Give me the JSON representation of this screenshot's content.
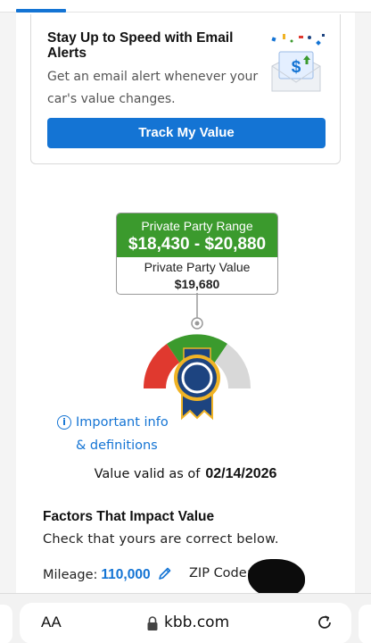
{
  "alert": {
    "title": "Stay Up to Speed with Email Alerts",
    "description": "Get an email alert whenever your car's value changes.",
    "button_label": "Track My Value"
  },
  "valuation": {
    "range_label": "Private Party Range",
    "range_value": "$18,430 - $20,880",
    "value_label": "Private Party Value",
    "value": "$19,680"
  },
  "info": {
    "icon_glyph": "i",
    "line1": "Important info",
    "line2": "& definitions"
  },
  "validity": {
    "label": "Value valid as of",
    "date": "02/14/2026"
  },
  "factors": {
    "title": "Factors That Impact Value",
    "subtitle": "Check that yours are correct below.",
    "mileage_label": "Mileage:",
    "mileage_value": "110,000",
    "zip_label": "ZIP Code:"
  },
  "browser": {
    "text_size_label": "AA",
    "url": "kbb.com"
  },
  "colors": {
    "accent_blue": "#1474d4",
    "range_green": "#3b9a2d",
    "gauge_red": "#e0392f",
    "gauge_grey": "#d8d8d8",
    "badge_navy": "#1d4480",
    "badge_gold": "#f0b325"
  }
}
